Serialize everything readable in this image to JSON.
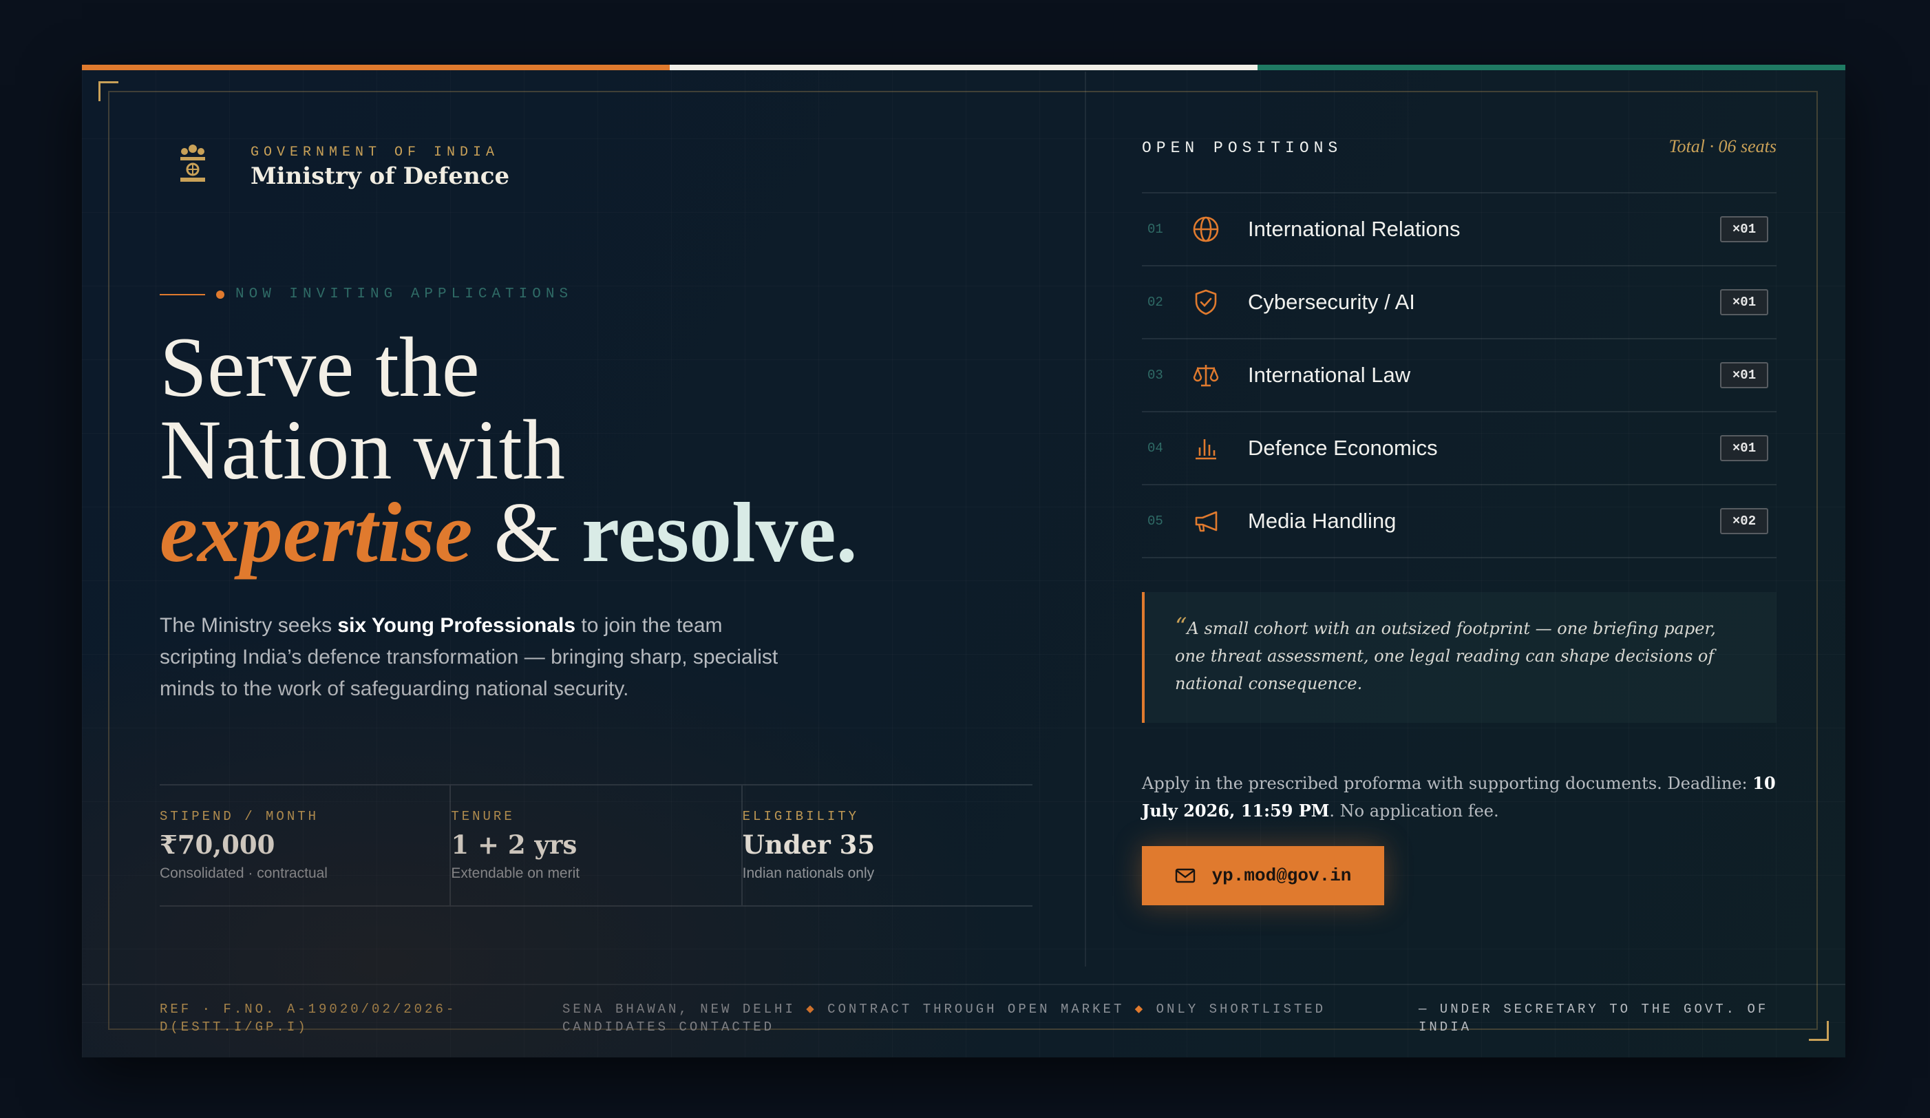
{
  "tricolor": [
    "#e07a2e",
    "#f2efe8",
    "#1f7a63"
  ],
  "header": {
    "gov_label": "GOVERNMENT OF INDIA",
    "ministry": "Ministry of Defence",
    "emblem_icon": "national-emblem-icon"
  },
  "hero": {
    "invite": "NOW INVITING APPLICATIONS",
    "line1": "Serve the",
    "line2": "Nation with",
    "emphasis": "expertise",
    "amp": " & ",
    "resolve": "resolve."
  },
  "intro": {
    "before": "The Ministry seeks ",
    "bold": "six Young Professionals",
    "after": " to join the team scripting India’s defence transformation — bringing sharp, specialist minds to the work of safeguarding national security."
  },
  "stats": [
    {
      "key": "STIPEND / MONTH",
      "value": "₹70,000",
      "sub": "Consolidated · contractual"
    },
    {
      "key": "TENURE",
      "value": "1 + 2 yrs",
      "sub": "Extendable on merit"
    },
    {
      "key": "ELIGIBILITY",
      "value": "Under 35",
      "sub": "Indian nationals only"
    }
  ],
  "positions": {
    "title": "OPEN POSITIONS",
    "total": "Total · 06 seats",
    "items": [
      {
        "num": "01",
        "label": "International Relations",
        "count": "×01",
        "icon": "globe-icon"
      },
      {
        "num": "02",
        "label": "Cybersecurity / AI",
        "count": "×01",
        "icon": "shield-check-icon"
      },
      {
        "num": "03",
        "label": "International Law",
        "count": "×01",
        "icon": "scales-icon"
      },
      {
        "num": "04",
        "label": "Defence Economics",
        "count": "×01",
        "icon": "bar-chart-icon"
      },
      {
        "num": "05",
        "label": "Media Handling",
        "count": "×02",
        "icon": "megaphone-icon"
      }
    ]
  },
  "quote": {
    "mark": "“",
    "text": "A small cohort with an outsized footprint — one briefing paper, one threat assessment, one legal reading can shape decisions of national consequence."
  },
  "apply": {
    "before": "Apply in the prescribed proforma with supporting documents. Deadline: ",
    "deadline": "10 July 2026, 11:59 PM",
    "after": ". No application fee."
  },
  "cta": {
    "email": "yp.mod@gov.in",
    "icon": "mail-icon"
  },
  "footer": {
    "ref": "REF · F.NO. A-19020/02/2026-D(ESTT.I/GP.I)",
    "mid_1": "SENA BHAWAN, NEW DELHI ",
    "mid_sep": "◆",
    "mid_2": " CONTRACT THROUGH OPEN MARKET ",
    "mid_3": " ONLY SHORTLISTED CANDIDATES CONTACTED",
    "sign": "— UNDER SECRETARY TO THE GOVT. OF INDIA"
  },
  "colors": {
    "accent": "#e07a2e",
    "gold": "#c9a158",
    "teal": "#2f6b66",
    "background": "#0a111c"
  }
}
